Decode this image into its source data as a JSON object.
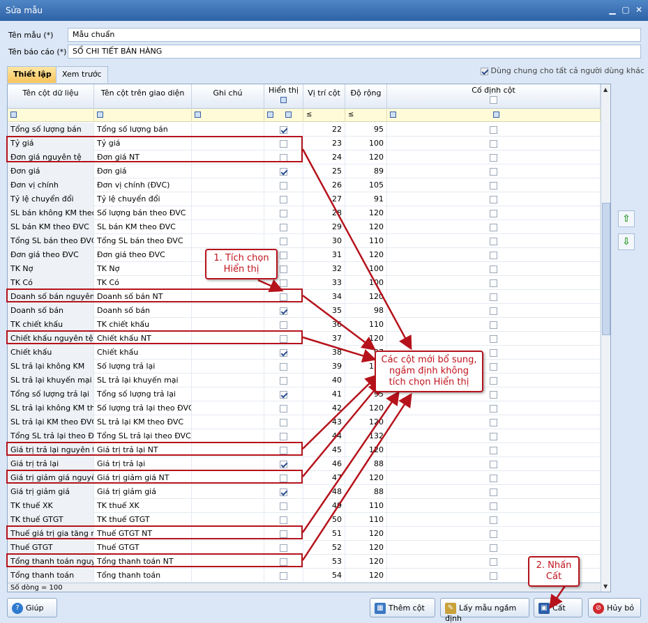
{
  "window": {
    "title": "Sửa mẫu"
  },
  "form": {
    "template_name_label": "Tên mẫu (*)",
    "template_name_value": "Mẫu chuẩn",
    "report_name_label": "Tên báo cáo (*)",
    "report_name_value": "SỔ CHI TIẾT BÁN HÀNG"
  },
  "tabs": [
    {
      "label": "Thiết lập"
    },
    {
      "label": "Xem trước"
    }
  ],
  "share_label": "Dùng chung cho tất cả người dùng khác",
  "grid": {
    "headers": {
      "data_col": "Tên cột dữ liệu",
      "ui_col": "Tên cột trên giao diện",
      "note": "Ghi chú",
      "visible": "Hiển thị",
      "position": "Vị trí cột",
      "width": "Độ rộng",
      "fixed": "Cố định cột"
    },
    "filter_ops": {
      "position": "≤",
      "width": "≤"
    },
    "rows": [
      {
        "data": "Tổng số lượng bán",
        "ui": "Tổng số lượng bán",
        "visible": true,
        "pos": "22",
        "width": "95"
      },
      {
        "data": "Tỷ giá",
        "ui": "Tỷ giá",
        "visible": false,
        "pos": "23",
        "width": "100"
      },
      {
        "data": "Đơn giá nguyên tệ",
        "ui": "Đơn giá NT",
        "visible": false,
        "pos": "24",
        "width": "120"
      },
      {
        "data": "Đơn giá",
        "ui": "Đơn giá",
        "visible": true,
        "pos": "25",
        "width": "89"
      },
      {
        "data": "Đơn vị chính",
        "ui": "Đơn vị chính (ĐVC)",
        "visible": false,
        "pos": "26",
        "width": "105"
      },
      {
        "data": "Tỷ lệ chuyển đổi",
        "ui": "Tỷ lệ chuyển đổi",
        "visible": false,
        "pos": "27",
        "width": "91"
      },
      {
        "data": "SL bán không KM theo ĐVC",
        "ui": "Số lượng bán theo ĐVC",
        "visible": false,
        "pos": "28",
        "width": "120"
      },
      {
        "data": "SL bán KM theo ĐVC",
        "ui": "SL bán KM theo ĐVC",
        "visible": false,
        "pos": "29",
        "width": "120"
      },
      {
        "data": "Tổng SL bán theo ĐVC",
        "ui": "Tổng SL bán theo ĐVC",
        "visible": false,
        "pos": "30",
        "width": "110"
      },
      {
        "data": "Đơn giá theo ĐVC",
        "ui": "Đơn giá theo ĐVC",
        "visible": false,
        "pos": "31",
        "width": "120"
      },
      {
        "data": "TK Nợ",
        "ui": "TK Nợ",
        "visible": false,
        "pos": "32",
        "width": "100"
      },
      {
        "data": "TK Có",
        "ui": "TK Có",
        "visible": false,
        "pos": "33",
        "width": "100"
      },
      {
        "data": "Doanh số bán nguyên tệ",
        "ui": "Doanh số bán NT",
        "visible": false,
        "pos": "34",
        "width": "120"
      },
      {
        "data": "Doanh số bán",
        "ui": "Doanh số bán",
        "visible": true,
        "pos": "35",
        "width": "98"
      },
      {
        "data": "TK chiết khấu",
        "ui": "TK chiết khấu",
        "visible": false,
        "pos": "36",
        "width": "110"
      },
      {
        "data": "Chiết khấu nguyên tệ",
        "ui": "Chiết khấu NT",
        "visible": false,
        "pos": "37",
        "width": "120"
      },
      {
        "data": "Chiết khấu",
        "ui": "Chiết khấu",
        "visible": true,
        "pos": "38",
        "width": "97"
      },
      {
        "data": "SL trả lại không KM",
        "ui": "Số lượng trả lại",
        "visible": false,
        "pos": "39",
        "width": "120"
      },
      {
        "data": "SL trả lại khuyến mại",
        "ui": "SL trả lại khuyến mại",
        "visible": false,
        "pos": "40",
        "width": "120"
      },
      {
        "data": "Tổng số lượng trả lại",
        "ui": "Tổng số lượng trả lại",
        "visible": true,
        "pos": "41",
        "width": "95"
      },
      {
        "data": "SL trả lại không KM theo ĐVC",
        "ui": "Số lượng trả lại theo ĐVC",
        "visible": false,
        "pos": "42",
        "width": "120"
      },
      {
        "data": "SL trả lại KM theo ĐVC",
        "ui": "SL trả lại KM theo ĐVC",
        "visible": false,
        "pos": "43",
        "width": "120"
      },
      {
        "data": "Tổng SL trả lại theo ĐVC",
        "ui": "Tổng SL trả lại theo ĐVC",
        "visible": false,
        "pos": "44",
        "width": "132"
      },
      {
        "data": "Giá trị trả lại nguyên tệ",
        "ui": "Giá trị trả lại NT",
        "visible": false,
        "pos": "45",
        "width": "120"
      },
      {
        "data": "Giá trị trả lại",
        "ui": "Giá trị trả lại",
        "visible": true,
        "pos": "46",
        "width": "88"
      },
      {
        "data": "Giá trị giảm giá nguyên tệ",
        "ui": "Giá trị giảm giá NT",
        "visible": false,
        "pos": "47",
        "width": "120"
      },
      {
        "data": "Giá trị giảm giá",
        "ui": "Giá trị giảm giá",
        "visible": true,
        "pos": "48",
        "width": "88"
      },
      {
        "data": "TK thuế XK",
        "ui": "TK thuế XK",
        "visible": false,
        "pos": "49",
        "width": "110"
      },
      {
        "data": "TK thuế GTGT",
        "ui": "TK thuế GTGT",
        "visible": false,
        "pos": "50",
        "width": "110"
      },
      {
        "data": "Thuế giá trị gia tăng nguyên tệ",
        "ui": "Thuế GTGT NT",
        "visible": false,
        "pos": "51",
        "width": "120"
      },
      {
        "data": "Thuế GTGT",
        "ui": "Thuế GTGT",
        "visible": false,
        "pos": "52",
        "width": "120"
      },
      {
        "data": "Tổng thanh toán nguyên tệ",
        "ui": "Tổng thanh toán NT",
        "visible": false,
        "pos": "53",
        "width": "120"
      },
      {
        "data": "Tổng thanh toán",
        "ui": "Tổng thanh toán",
        "visible": false,
        "pos": "54",
        "width": "120"
      }
    ],
    "footer": "Số dòng = 100"
  },
  "buttons": {
    "help": "Giúp",
    "add_column": "Thêm cột",
    "get_default": "Lấy mẫu ngầm định",
    "save": "Cất",
    "cancel": "Hủy bỏ"
  },
  "annotations": {
    "step1": "1. Tích chọn Hiển thị",
    "step2": "2. Nhấn Cất",
    "note": "Các cột mới bổ sung, ngầm định không tích chọn Hiển thị"
  },
  "colors": {
    "titlebar": "#2f63a8",
    "highlight": "#b5121b",
    "tab_active": "#f7c35b"
  }
}
